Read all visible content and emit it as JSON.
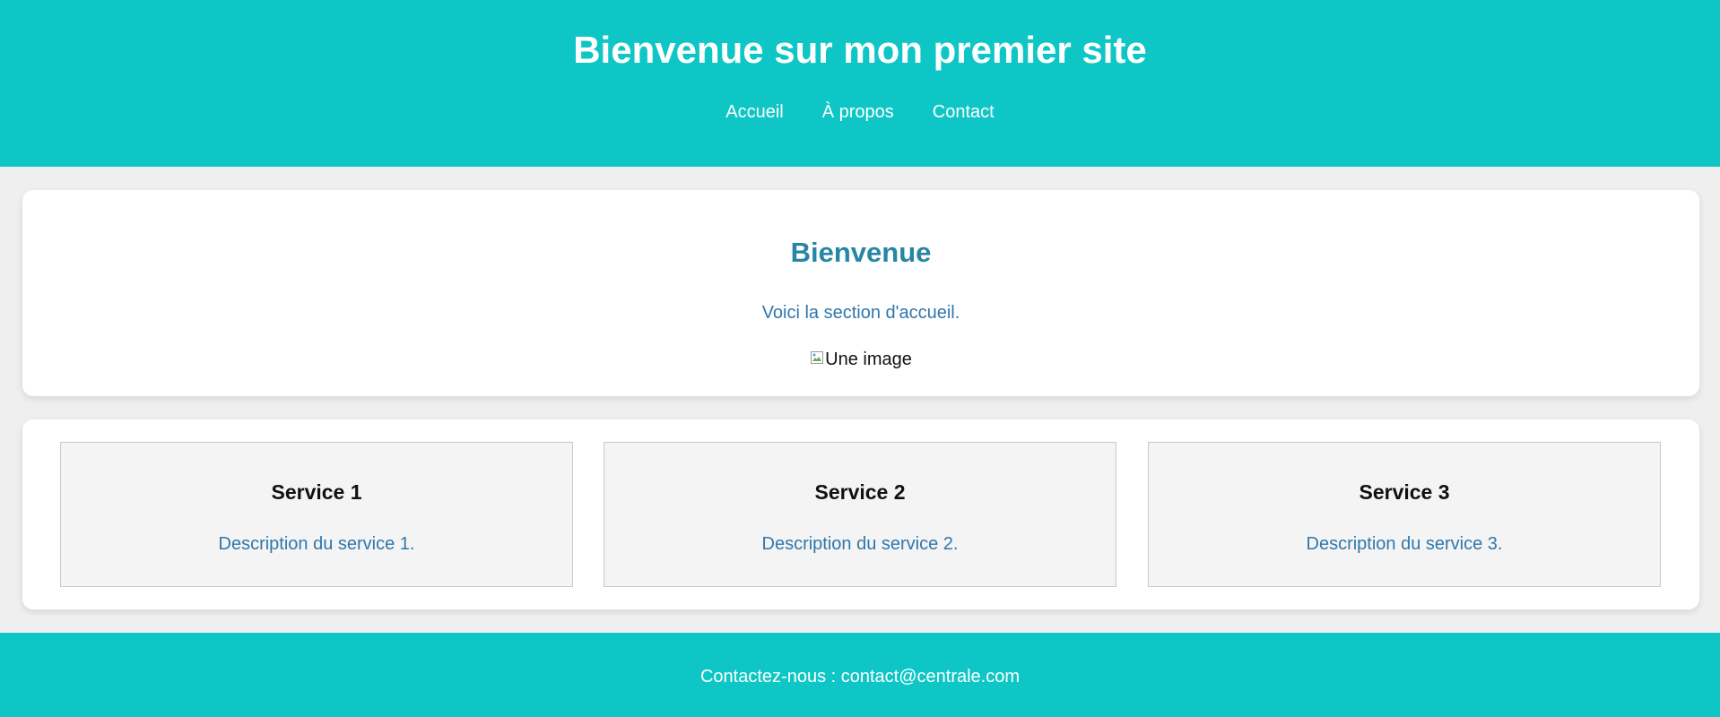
{
  "header": {
    "title": "Bienvenue sur mon premier site",
    "nav": [
      "Accueil",
      "À propos",
      "Contact"
    ]
  },
  "welcome": {
    "title": "Bienvenue",
    "text": "Voici la section d'accueil.",
    "image_alt": "Une image"
  },
  "services": [
    {
      "title": "Service 1",
      "description": "Description du service 1."
    },
    {
      "title": "Service 2",
      "description": "Description du service 2."
    },
    {
      "title": "Service 3",
      "description": "Description du service 3."
    }
  ],
  "footer": {
    "text": "Contactez-nous : contact@centrale.com"
  },
  "colors": {
    "header_bg": "#0fc6c6",
    "accent_title": "#2586a5",
    "link_blue": "#2f77ad",
    "page_bg": "#efefef"
  },
  "icons": {
    "broken_image": "broken-image-icon"
  }
}
